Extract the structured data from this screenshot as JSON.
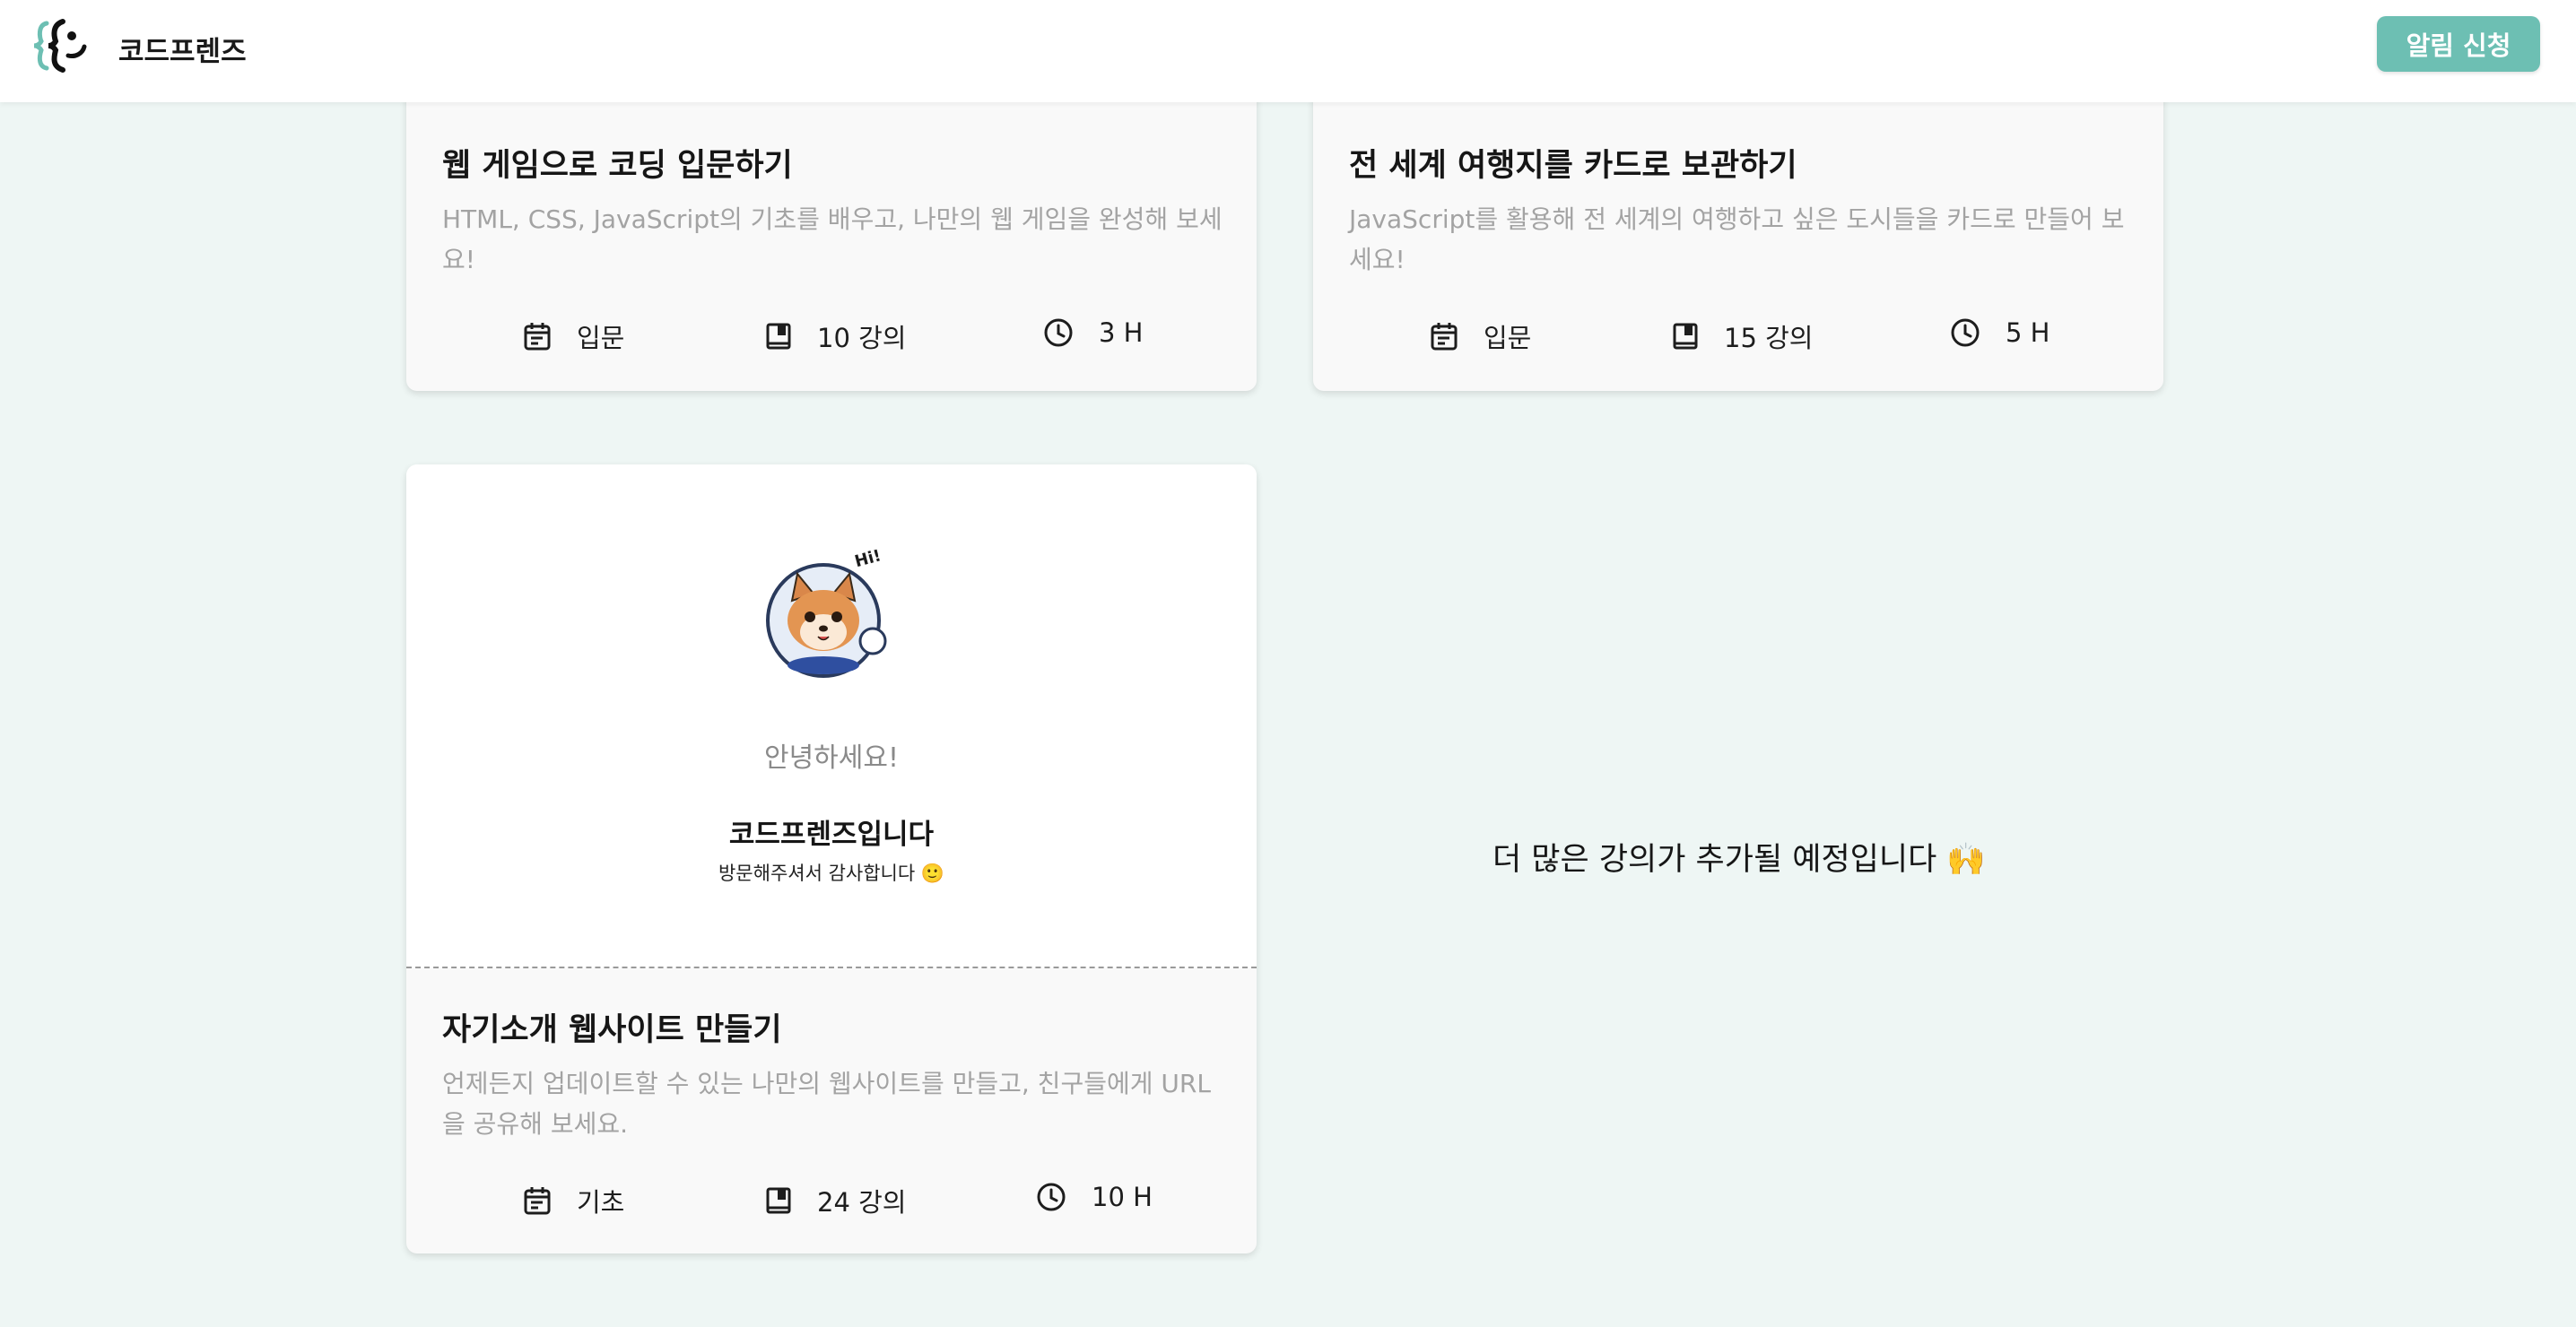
{
  "header": {
    "brand": "코드프렌즈",
    "notify_button": "알림 신청",
    "logo_icon": "codefriends-logo-icon"
  },
  "colors": {
    "accent": "#6dbfb3",
    "page_background": "#eef6f4",
    "card_background": "#f9f9f9",
    "muted_text": "#a3a3a3"
  },
  "courses": [
    {
      "title": "웹 게임으로 코딩 입문하기",
      "description": "HTML, CSS, JavaScript의 기초를 배우고, 나만의 웹 게임을 완성해 보세요!",
      "level": "입문",
      "lessons": "10 강의",
      "duration": "3 H"
    },
    {
      "title": "전 세계 여행지를 카드로 보관하기",
      "description": "JavaScript를 활용해 전 세계의 여행하고 싶은 도시들을 카드로 만들어 보세요!",
      "level": "입문",
      "lessons": "15 강의",
      "duration": "5 H"
    },
    {
      "title": "자기소개 웹사이트 만들기",
      "description": "언제든지 업데이트할 수 있는 나만의 웹사이트를 만들고, 친구들에게 URL을 공유해 보세요.",
      "level": "기초",
      "lessons": "24 강의",
      "duration": "10 H",
      "preview": {
        "greeting": "안녕하세요!",
        "intro": "코드프렌즈입니다",
        "thanks": "방문해주셔서 감사합니다 🙂",
        "avatar_text": "Hi!"
      }
    }
  ],
  "icons": {
    "level": "calendar-icon",
    "lessons": "book-icon",
    "duration": "clock-icon"
  },
  "more_coming": "더 많은 강의가 추가될 예정입니다 🙌"
}
